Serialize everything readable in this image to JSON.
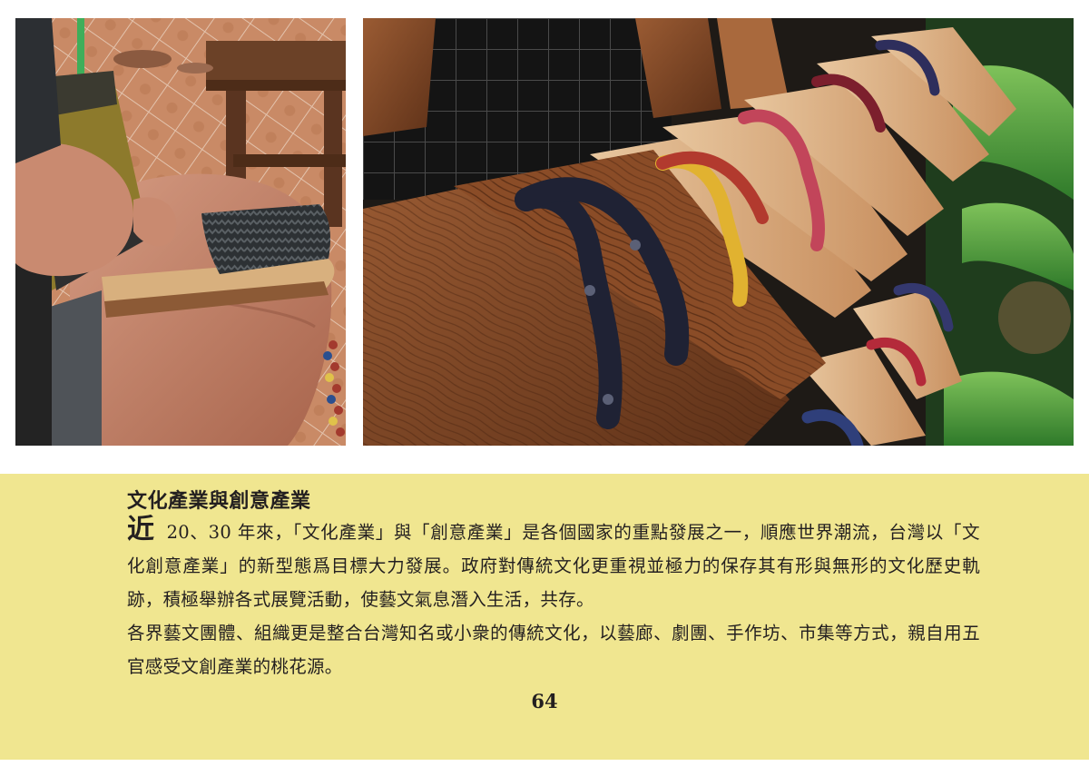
{
  "photos": {
    "left": {
      "alt": "Artisan stapling a rubber sole onto a wooden clog"
    },
    "right": {
      "alt": "Rows of wooden geta sandals with patterned fabric straps on display racks"
    }
  },
  "article": {
    "title": "文化產業與創意產業",
    "dropcap": "近",
    "para1_rest": " 20、30 年來，「文化產業」與「創意產業」是各個國家的重點發展之一，順應世界潮流，台灣以「文化創意產業」的新型態爲目標大力發展。政府對傳統文化更重視並極力的保存其有形與無形的文化歷史軌跡，積極舉辦各式展覽活動，使藝文氣息潛入生活，共存。",
    "para2": "各界藝文團體、組織更是整合台灣知名或小衆的傳統文化，以藝廊、劇團、手作坊、市集等方式，親自用五官感受文創產業的桃花源。"
  },
  "page_number": "64",
  "colors": {
    "band": "#f0e690",
    "text": "#231f20"
  }
}
